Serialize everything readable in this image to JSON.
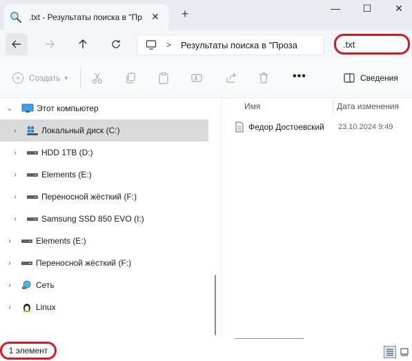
{
  "window": {
    "tab_title": ".txt - Результаты поиска в \"Пр",
    "tab_close": "✕",
    "new_tab": "+",
    "minimize": "—",
    "maximize": "☐",
    "close": "✕"
  },
  "address": {
    "chevron": ">",
    "breadcrumb": "Результаты поиска в \"Проза",
    "search_value": ".txt"
  },
  "toolbar": {
    "create_label": "Создать",
    "more_label": "•••",
    "details_label": "Сведения"
  },
  "nav": {
    "items": [
      {
        "label": "Этот компьютер",
        "icon": "monitor-icon",
        "level": 0,
        "expanded": true
      },
      {
        "label": "Локальный диск (C:)",
        "icon": "windows-drive-icon",
        "level": 1,
        "selected": true
      },
      {
        "label": "HDD 1TB (D:)",
        "icon": "drive-icon",
        "level": 1
      },
      {
        "label": "Elements (E:)",
        "icon": "drive-icon",
        "level": 1
      },
      {
        "label": "Переносной жёсткий (F:)",
        "icon": "drive-icon",
        "level": 1
      },
      {
        "label": "Samsung SSD 850 EVO (I:)",
        "icon": "drive-icon",
        "level": 1
      },
      {
        "label": "Elements (E:)",
        "icon": "drive-icon",
        "level": 0
      },
      {
        "label": "Переносной жёсткий (F:)",
        "icon": "drive-icon",
        "level": 0
      },
      {
        "label": "Сеть",
        "icon": "network-icon",
        "level": 0
      },
      {
        "label": "Linux",
        "icon": "linux-penguin-icon",
        "level": 0
      }
    ]
  },
  "content": {
    "columns": {
      "name": "Имя",
      "date": "Дата изменения"
    },
    "files": [
      {
        "name": "Федор Достоевский - Бедные люди.txt",
        "date": "23.10.2024 9:49",
        "icon": "text-file-icon"
      }
    ]
  },
  "status": {
    "count": "1 элемент"
  },
  "colors": {
    "highlight_red": "#e0141e",
    "selection_gray": "#dadada",
    "title_bar": "#e8ecf1"
  }
}
